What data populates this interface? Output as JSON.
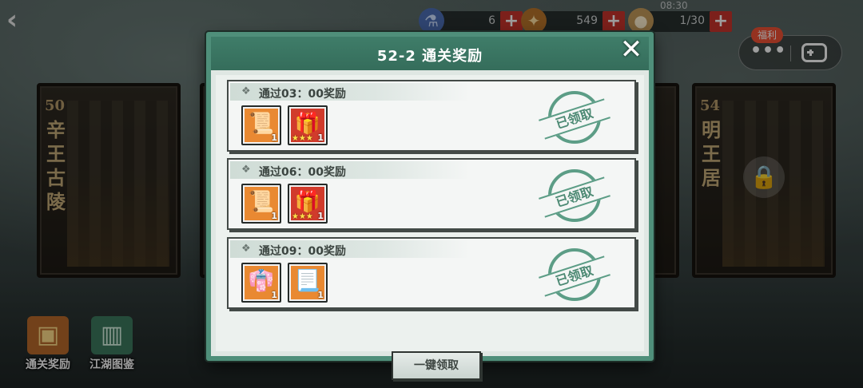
{
  "top_bar": {
    "resources": [
      {
        "icon": "stamina-icon",
        "value": "6"
      },
      {
        "icon": "gold-icon",
        "value": "549"
      },
      {
        "icon": "pouch-icon",
        "value": "1/30"
      }
    ],
    "timer": "08:30",
    "plus_label": "+"
  },
  "mini_program": {
    "welfare_badge": "福利",
    "more_label": "•••"
  },
  "stages": {
    "left": {
      "number": "50",
      "name": "辛王古陵"
    },
    "right": {
      "number": "54",
      "name": "明王居"
    }
  },
  "side_buttons": {
    "reward_label": "通关奖励",
    "codex_label": "江湖图鉴"
  },
  "modal": {
    "title": "52-2 通关奖励",
    "close_label": "✕",
    "rows": [
      {
        "label": "通过03：00奖励",
        "stamp": "已领取",
        "items": [
          {
            "icon": "scroll-icon",
            "qty": "1"
          },
          {
            "icon": "chest-icon",
            "qty": "1",
            "stars": "★★★"
          }
        ]
      },
      {
        "label": "通过06：00奖励",
        "stamp": "已领取",
        "items": [
          {
            "icon": "scroll-icon",
            "qty": "1"
          },
          {
            "icon": "chest-icon",
            "qty": "1",
            "stars": "★★★"
          }
        ]
      },
      {
        "label": "通过09：00奖励",
        "stamp": "已领取",
        "items": [
          {
            "icon": "robe-icon",
            "qty": "1"
          },
          {
            "icon": "manual-icon",
            "qty": "1"
          }
        ]
      }
    ],
    "claim_all_label": "一键领取"
  }
}
